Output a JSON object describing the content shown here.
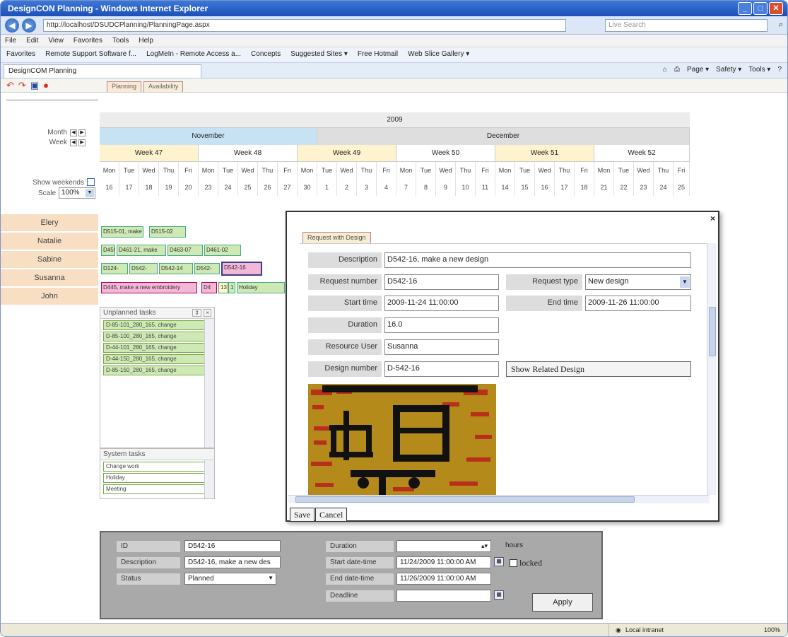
{
  "window": {
    "title": "DesignCON Planning - Windows Internet Explorer"
  },
  "browser": {
    "url": "http://localhost/DSUDCPlanning/PlanningPage.aspx",
    "search_placeholder": "Live Search",
    "menu": [
      "File",
      "Edit",
      "View",
      "Favorites",
      "Tools",
      "Help"
    ],
    "favorites": [
      "Favorites",
      "Remote Support Software f...",
      "LogMeIn - Remote Access a...",
      "Concepts",
      "Suggested Sites ▾",
      "Free Hotmail",
      "Web Slice Gallery ▾"
    ],
    "tab_label": "DesignCOM Planning",
    "tab_tools": [
      "Page ▾",
      "Safety ▾",
      "Tools ▾"
    ]
  },
  "app": {
    "tabs": [
      "Planning",
      "Availability"
    ],
    "controls": {
      "month_label": "Month",
      "week_label": "Week",
      "show_weekends_label": "Show weekends",
      "scale_label": "Scale",
      "scale_value": "100%"
    },
    "calendar": {
      "year": "2009",
      "months": [
        "November",
        "December"
      ],
      "weeks": [
        "Week 47",
        "Week 48",
        "Week 49",
        "Week 50",
        "Week 51",
        "Week 52"
      ],
      "days": [
        "Mon",
        "Tue",
        "Wed",
        "Thu",
        "Fri",
        "Mon",
        "Tue",
        "Wed",
        "Thu",
        "Fri",
        "Mon",
        "Tue",
        "Wed",
        "Thu",
        "Fri",
        "Mon",
        "Tue",
        "Wed",
        "Thu",
        "Fri",
        "Mon",
        "Tue",
        "Wed",
        "Thu",
        "Fri",
        "Mon",
        "Tue",
        "Wed",
        "Thu",
        "Fri"
      ],
      "dates": [
        "16",
        "17",
        "18",
        "19",
        "20",
        "23",
        "24",
        "25",
        "26",
        "27",
        "30",
        "1",
        "2",
        "3",
        "4",
        "7",
        "8",
        "9",
        "10",
        "11",
        "14",
        "15",
        "16",
        "17",
        "18",
        "21",
        "22",
        "23",
        "24",
        "25"
      ]
    },
    "resources": [
      "Elery",
      "Natalie",
      "Sabine",
      "Susanna",
      "John"
    ],
    "tasks": {
      "natalie": [
        "D515-01, make",
        "D515-02"
      ],
      "sabine": [
        "D459",
        "D461-21, make",
        "D463-07",
        "D461-02"
      ],
      "susanna": [
        "D124-",
        "D542-",
        "D542-14",
        "D542-",
        "D542-16"
      ],
      "john": [
        "D445, make a new embroidery",
        "D4",
        "13",
        "1",
        "Holiday"
      ]
    },
    "unplanned": {
      "title": "Unplanned tasks",
      "items": [
        "D-85-101_280_165, change",
        "D-85-100_280_165, change",
        "D-44-101_280_165, change",
        "D-44-150_280_165, change",
        "D-85-150_280_165, change"
      ]
    },
    "system": {
      "title": "System tasks",
      "items": [
        "Change work",
        "Holiday",
        "Meeting"
      ]
    }
  },
  "dialog": {
    "tab": "Request with Design",
    "description_label": "Description",
    "description_value": "D542-16, make a new design",
    "request_number_label": "Request number",
    "request_number_value": "D542-16",
    "request_type_label": "Request type",
    "request_type_value": "New design",
    "start_time_label": "Start time",
    "start_time_value": "2009-11-24 11:00:00",
    "end_time_label": "End time",
    "end_time_value": "2009-11-26 11:00:00",
    "duration_label": "Duration",
    "duration_value": "16.0",
    "resource_user_label": "Resource User",
    "resource_user_value": "Susanna",
    "design_number_label": "Design number",
    "design_number_value": "D-542-16",
    "show_related_label": "Show Related Design",
    "save_label": "Save",
    "cancel_label": "Cancel"
  },
  "bottom_form": {
    "id_label": "ID",
    "id_value": "D542-16",
    "description_label": "Description",
    "description_value": "D542-16, make a new des",
    "status_label": "Status",
    "status_value": "Planned",
    "duration_label": "Duration",
    "duration_unit": "hours",
    "start_label": "Start date-time",
    "start_value": "11/24/2009 11:00:00 AM",
    "locked_label": "locked",
    "end_label": "End date-time",
    "end_value": "11/26/2009 11:00:00 AM",
    "deadline_label": "Deadline",
    "apply_label": "Apply"
  },
  "statusbar": {
    "zone": "Local intranet",
    "zoom": "100%"
  }
}
